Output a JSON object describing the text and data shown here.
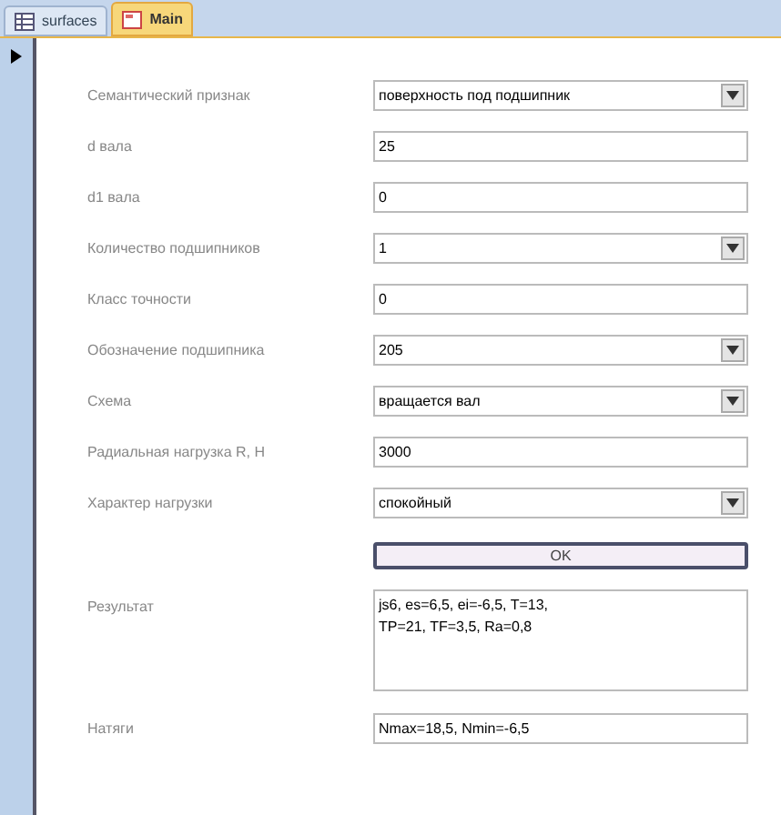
{
  "tabs": [
    {
      "label": "surfaces",
      "selected": false
    },
    {
      "label": "Main",
      "selected": true
    }
  ],
  "fields": [
    {
      "kind": "combo",
      "label": "Семантический признак",
      "value": "поверхность под подшипник"
    },
    {
      "kind": "text",
      "label": "d вала",
      "value": "25"
    },
    {
      "kind": "text",
      "label": "d1 вала",
      "value": "0"
    },
    {
      "kind": "combo",
      "label": "Количество подшипников",
      "value": "1"
    },
    {
      "kind": "text",
      "label": "Класс точности",
      "value": "0"
    },
    {
      "kind": "combo",
      "label": "Обозначение подшипника",
      "value": "205"
    },
    {
      "kind": "combo",
      "label": "Схема",
      "value": "вращается вал"
    },
    {
      "kind": "text",
      "label": "Радиальная нагрузка R, H",
      "value": "3000"
    },
    {
      "kind": "combo",
      "label": "Характер нагрузки",
      "value": "спокойный"
    }
  ],
  "ok_button": "OK",
  "result": {
    "label": "Результат",
    "value": "js6, es=6,5, ei=-6,5, T=13,\nTP=21, TF=3,5, Ra=0,8"
  },
  "interference": {
    "label": "Натяги",
    "value": "Nmax=18,5, Nmin=-6,5"
  }
}
